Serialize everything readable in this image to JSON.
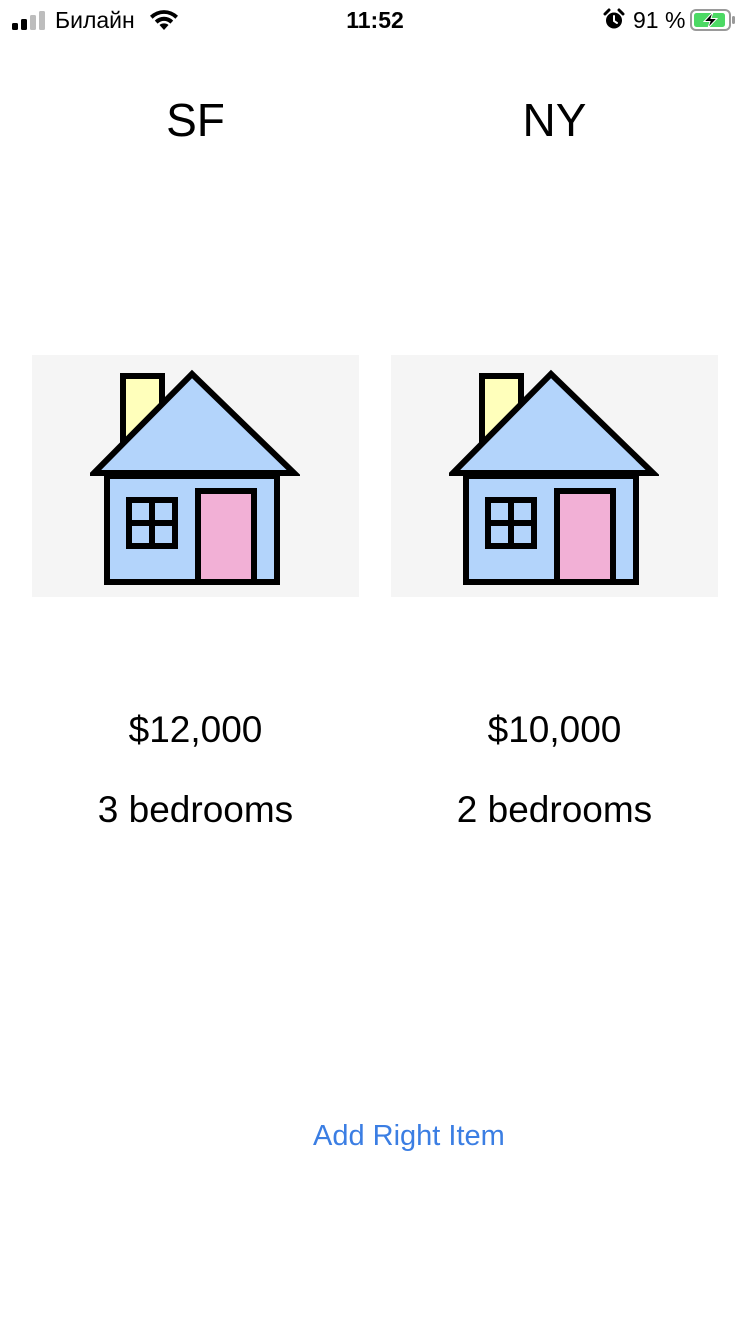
{
  "status_bar": {
    "carrier": "Билайн",
    "time": "11:52",
    "battery_percent": "91 %",
    "icons": [
      "cellular-signal-icon",
      "wifi-icon",
      "alarm-icon",
      "battery-charging-icon"
    ]
  },
  "listings": [
    {
      "city": "SF",
      "price": "$12,000",
      "bedrooms": "3 bedrooms",
      "image_icon": "house-icon"
    },
    {
      "city": "NY",
      "price": "$10,000",
      "bedrooms": "2 bedrooms",
      "image_icon": "house-icon"
    }
  ],
  "actions": {
    "add_right_item": "Add Right Item"
  },
  "colors": {
    "accent": "#3b7ee3",
    "house_wall": "#b3d4fb",
    "house_roof": "#b3d4fb",
    "house_door": "#f2b0d6",
    "chimney": "#ffffbb",
    "card_background": "#f5f5f5",
    "battery_fill": "#4cd964"
  }
}
